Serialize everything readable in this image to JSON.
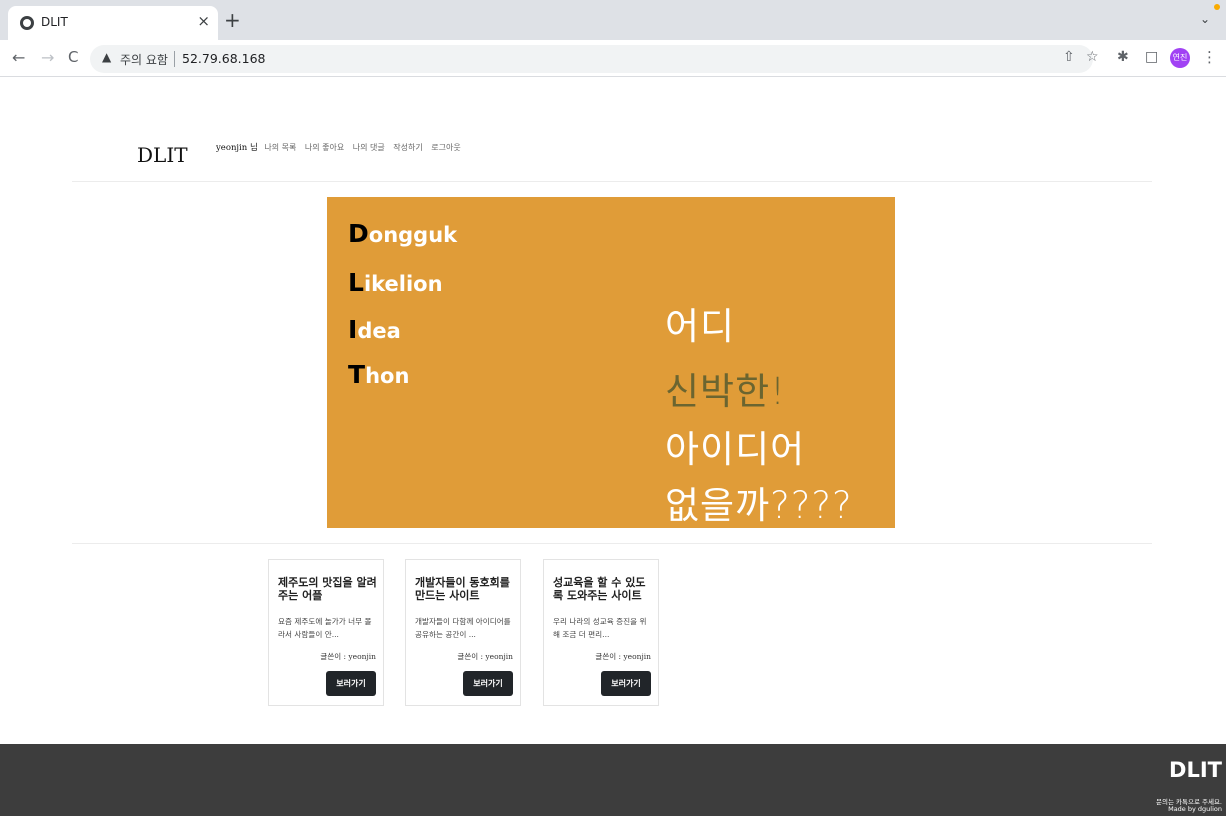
{
  "browser": {
    "tab_title": "DLIT",
    "security_label": "주의 요함",
    "url": "52.79.68.168",
    "profile_initials": "연진"
  },
  "site": {
    "logo": "DLIT",
    "user_greeting": "yeonjin 님",
    "nav": [
      "나의 목록",
      "나의 좋아요",
      "나의 댓글",
      "작성하기",
      "로그아웃"
    ]
  },
  "banner": {
    "acronym": [
      {
        "cap": "D",
        "rest": "ongguk"
      },
      {
        "cap": "L",
        "rest": "ikelion"
      },
      {
        "cap": "I",
        "rest": "dea"
      },
      {
        "cap": "T",
        "rest": "hon"
      }
    ],
    "slogan": [
      "어디",
      "신박한!",
      "아이디어",
      "없을까????"
    ],
    "colors": {
      "background": "#e09c38",
      "accent": "#6b6530"
    }
  },
  "cards": [
    {
      "title": "제주도의 맛집을 알려주는 어플",
      "desc": "요즘 제주도에 놀가가 너무 몰라서 사람들이 안...",
      "author": "글쓴이 : yeonjin",
      "button": "보러가기"
    },
    {
      "title": "개발자들이 동호회를 만드는 사이트",
      "desc": "개발자들이 다함께 아이디어를 공유하는 공간이 ...",
      "author": "글쓴이 : yeonjin",
      "button": "보러가기"
    },
    {
      "title": "성교육을 할 수 있도록 도와주는 사이트",
      "desc": "우리 나라의 성교육 증진을 위해 조금 더 편리...",
      "author": "글쓴이 : yeonjin",
      "button": "보러가기"
    }
  ],
  "footer": {
    "logo": "DLIT",
    "line1": "문의는 카톡으로 주세요.",
    "line2": "Made by dgulion"
  }
}
